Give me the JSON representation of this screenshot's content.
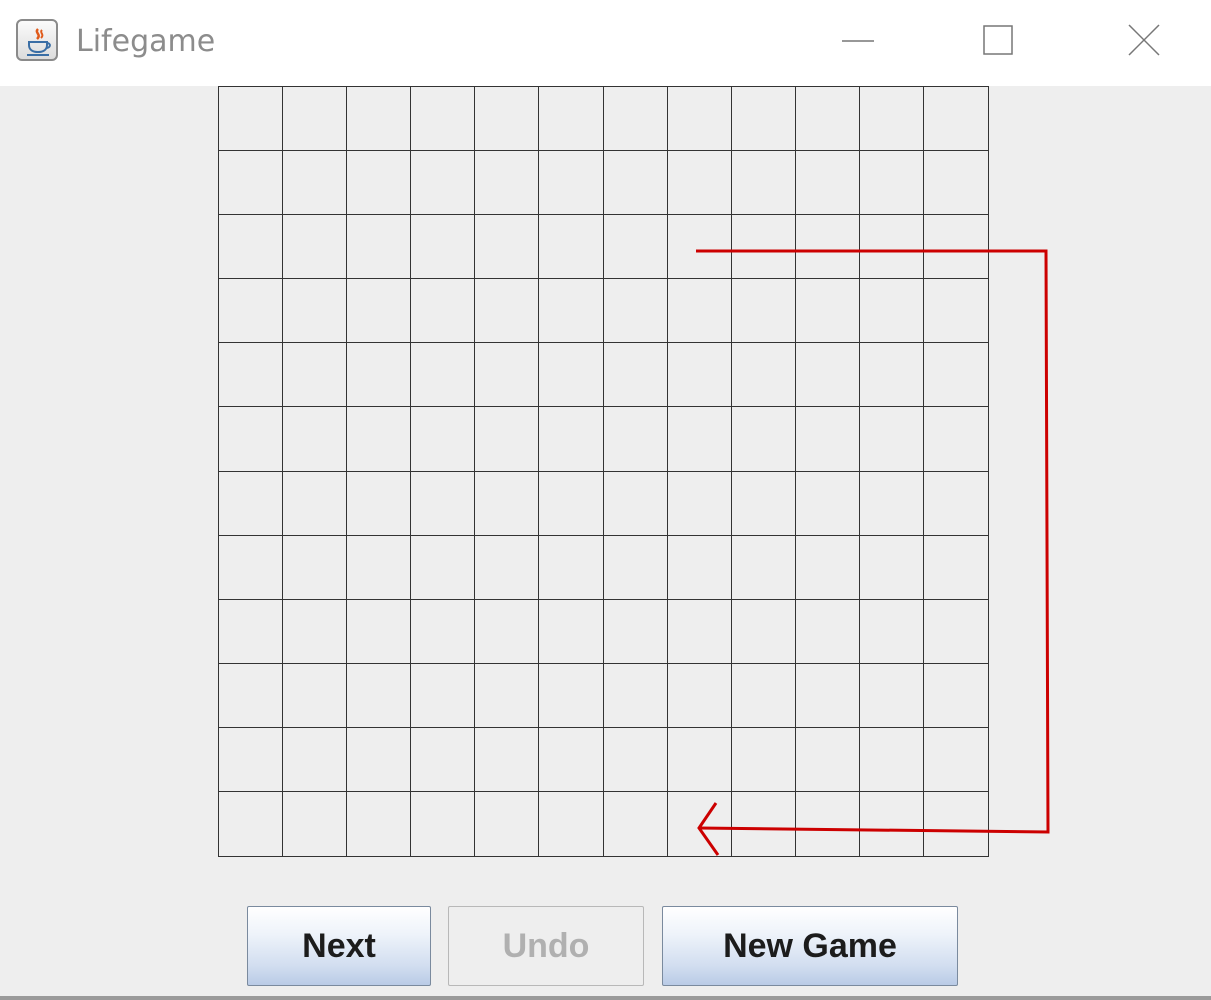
{
  "window": {
    "title": "Lifegame",
    "app_icon": "java-cup-icon",
    "controls": [
      "minimize-icon",
      "maximize-icon",
      "close-icon"
    ]
  },
  "board": {
    "rows": 12,
    "columns": 12
  },
  "annotation": {
    "color": "#cc0000",
    "shape": "arrow-right-down-left"
  },
  "buttons": {
    "next_label": "Next",
    "undo_label": "Undo",
    "new_game_label": "New Game"
  },
  "colors": {
    "background": "#eeeeee",
    "grid_line": "#333333",
    "disabled_text": "#b0b0b0"
  }
}
